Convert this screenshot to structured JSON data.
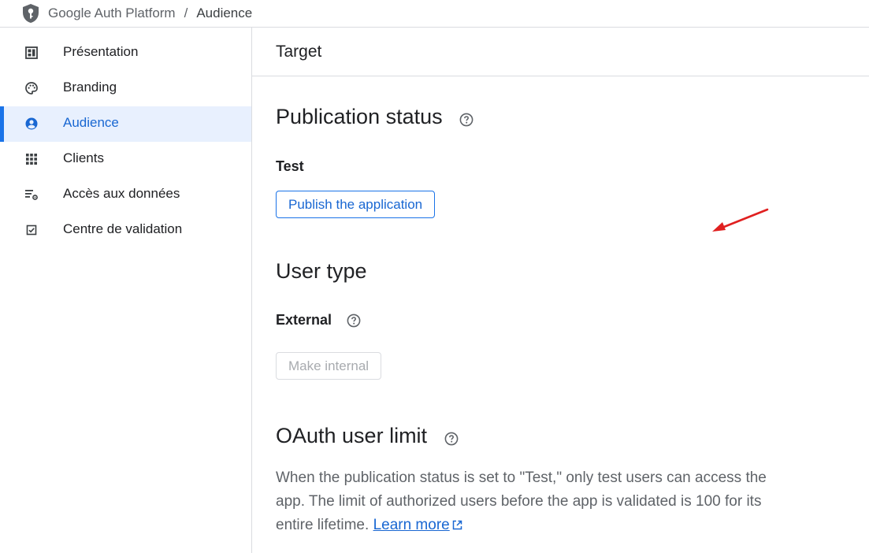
{
  "breadcrumb": {
    "root": "Google Auth Platform",
    "separator": "/",
    "current": "Audience"
  },
  "sidebar": {
    "items": [
      {
        "label": "Présentation",
        "icon": "dashboard-icon"
      },
      {
        "label": "Branding",
        "icon": "palette-icon"
      },
      {
        "label": "Audience",
        "icon": "account-circle-icon",
        "active": true
      },
      {
        "label": "Clients",
        "icon": "apps-grid-icon"
      },
      {
        "label": "Accès aux données",
        "icon": "data-settings-icon"
      },
      {
        "label": "Centre de validation",
        "icon": "checkbox-icon"
      }
    ]
  },
  "main": {
    "title": "Target",
    "publication": {
      "title": "Publication status",
      "status": "Test",
      "button": "Publish the application"
    },
    "user_type": {
      "title": "User type",
      "value": "External",
      "button": "Make internal"
    },
    "oauth_limit": {
      "title": "OAuth user limit",
      "text": "When the publication status is set to \"Test,\" only test users can access the app. The limit of authorized users before the app is validated is 100 for its entire lifetime.",
      "link": "Learn more"
    }
  },
  "colors": {
    "accent": "#1a73e8",
    "active_bg": "#e8f0fe",
    "annotation_arrow": "#e02020"
  }
}
